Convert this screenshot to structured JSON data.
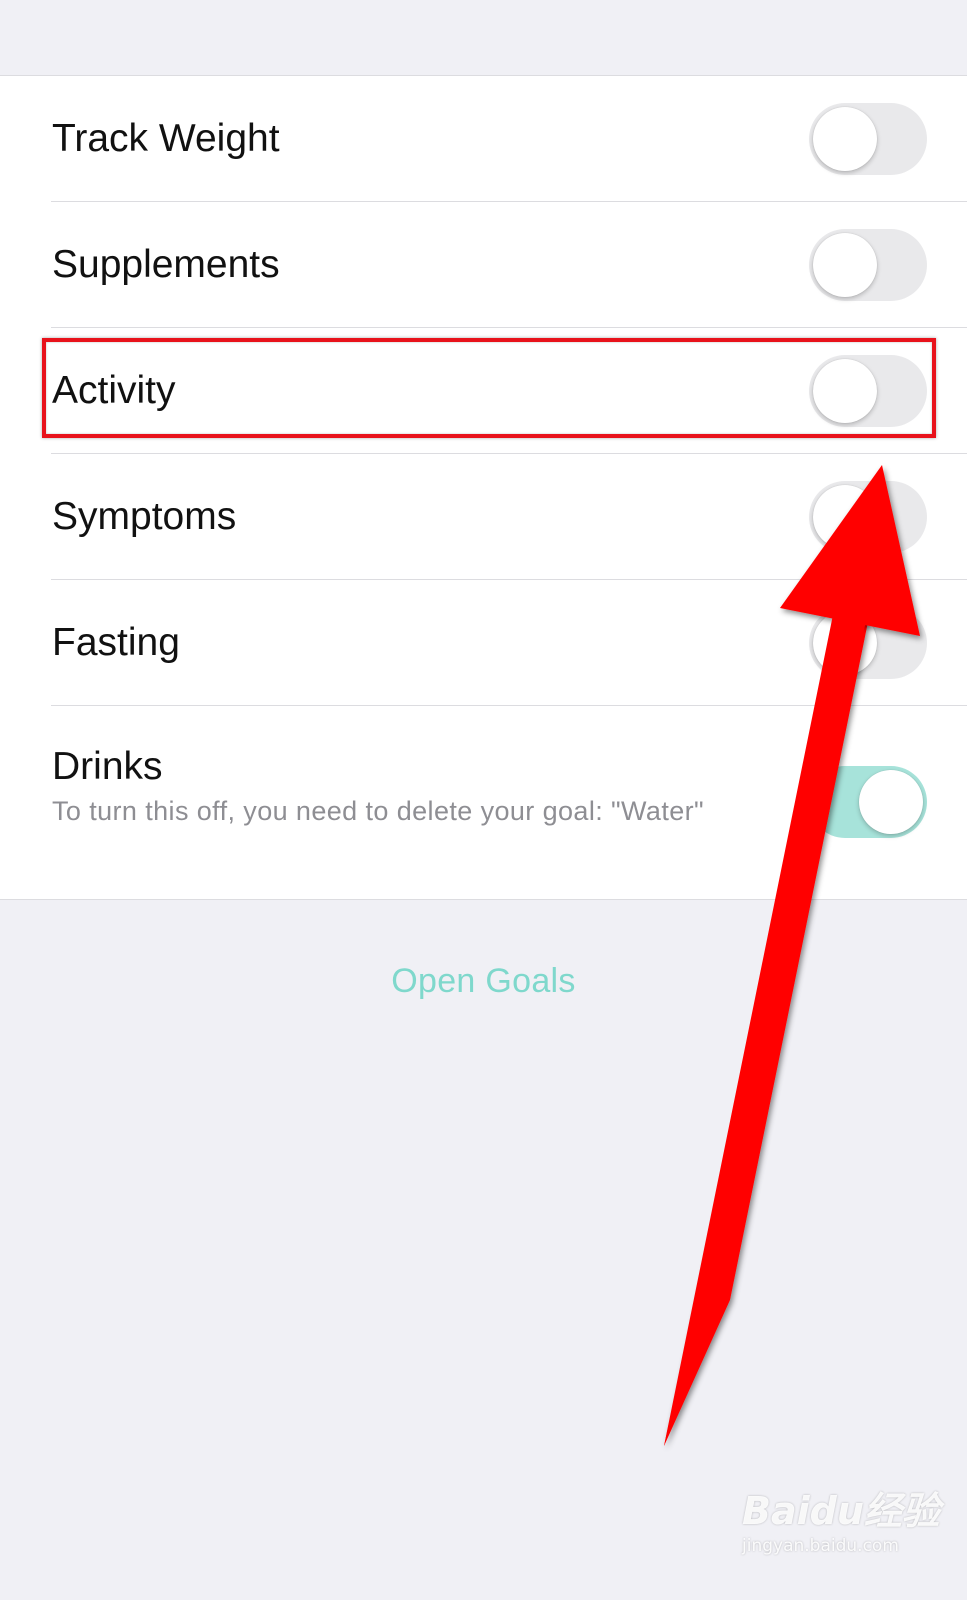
{
  "settings": {
    "rows": [
      {
        "label": "Track Weight",
        "toggle_on": false
      },
      {
        "label": "Supplements",
        "toggle_on": false
      },
      {
        "label": "Activity",
        "toggle_on": false
      },
      {
        "label": "Symptoms",
        "toggle_on": false
      },
      {
        "label": "Fasting",
        "toggle_on": false
      },
      {
        "label": "Drinks",
        "sublabel": "To turn this off, you need to delete your goal: \"Water\"",
        "toggle_on": true
      }
    ]
  },
  "open_goals_label": "Open Goals",
  "annotation": {
    "highlighted_row": "Activity",
    "highlight_color": "#e8121b",
    "arrow_color": "#ff0000"
  },
  "watermark": {
    "brand": "Baidu经验",
    "url": "jingyan.baidu.com"
  },
  "colors": {
    "background": "#f0f0f5",
    "toggle_off": "#e9e9eb",
    "toggle_on": "#a7e3da",
    "accent": "#7fd8cc",
    "sublabel": "#8e8e93"
  }
}
